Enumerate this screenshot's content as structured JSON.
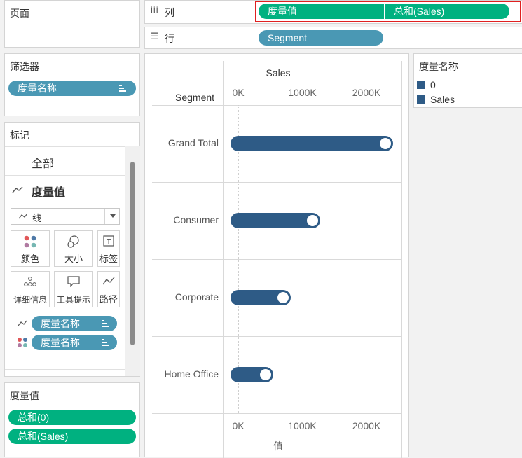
{
  "pages_shelf": {
    "title": "页面"
  },
  "filters_shelf": {
    "title": "筛选器",
    "pill": "度量名称"
  },
  "marks_card": {
    "title": "标记",
    "all_label": "全部",
    "measure_values_label": "度量值",
    "mark_type": "线",
    "buttons": {
      "color": "颜色",
      "size": "大小",
      "label": "标签",
      "detail": "详细信息",
      "tooltip": "工具提示",
      "path": "路径"
    },
    "pills": [
      "度量名称",
      "度量名称"
    ]
  },
  "measure_values_shelf": {
    "title": "度量值",
    "pills": [
      "总和(0)",
      "总和(Sales)"
    ]
  },
  "columns_shelf": {
    "label": "列",
    "pills": [
      "度量值",
      "总和(Sales)"
    ]
  },
  "rows_shelf": {
    "label": "行",
    "pills": [
      "Segment"
    ]
  },
  "legend": {
    "title": "度量名称",
    "items": [
      {
        "label": "0",
        "color": "#2e5b86"
      },
      {
        "label": "Sales",
        "color": "#2e5b86"
      }
    ]
  },
  "colors": {
    "pill_blue": "#4a98b4",
    "pill_green": "#00b180",
    "bar": "#2e5b86",
    "highlight_box": "#e02020"
  },
  "chart_data": {
    "type": "bar",
    "title": "",
    "top_axis_title": "Sales",
    "row_header": "Segment",
    "xlabel": "值",
    "categories": [
      "Grand Total",
      "Consumer",
      "Corporate",
      "Home Office"
    ],
    "series": [
      {
        "name": "0",
        "values": [
          0,
          0,
          0,
          0
        ]
      },
      {
        "name": "Sales",
        "values": [
          2300000,
          1160000,
          700000,
          430000
        ]
      }
    ],
    "xlim": [
      0,
      2500000
    ],
    "xticks": [
      0,
      1000000,
      2000000
    ],
    "xtick_labels": [
      "0K",
      "1000K",
      "2000K"
    ]
  }
}
